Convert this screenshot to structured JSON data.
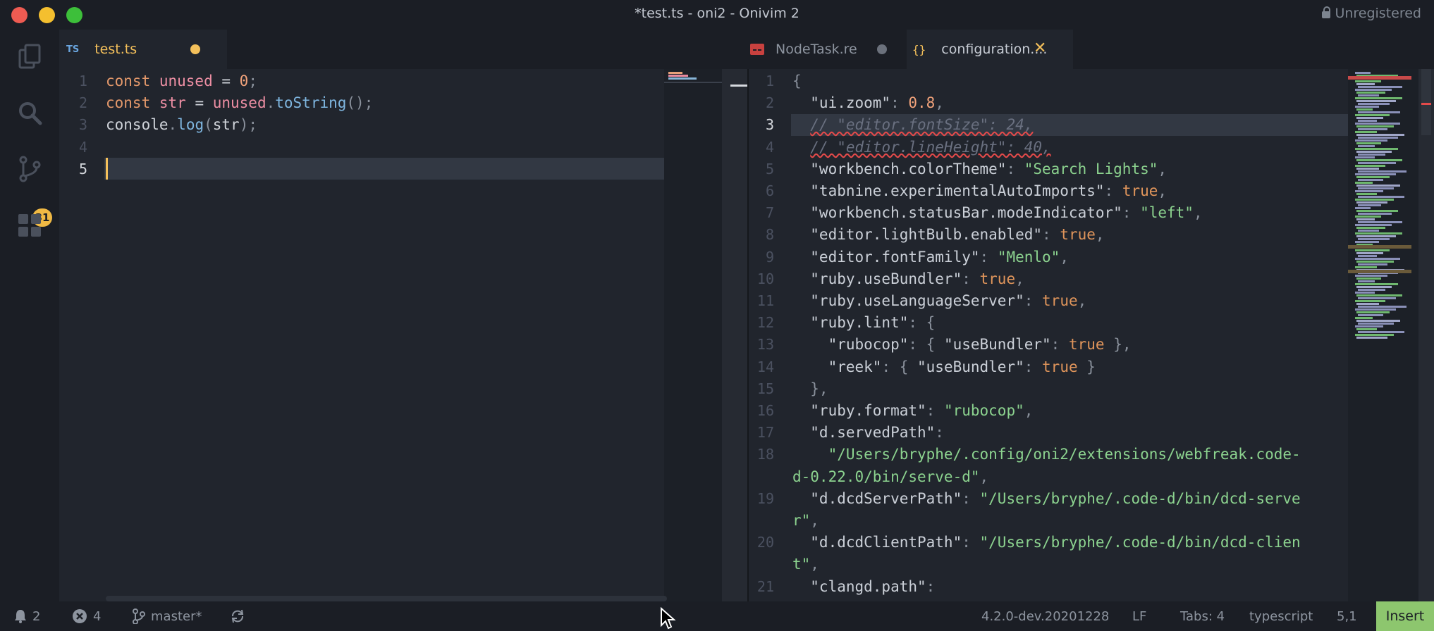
{
  "window": {
    "title": "*test.ts - oni2 - Onivim 2",
    "registration": "Unregistered"
  },
  "activity": {
    "scm_badge": "31"
  },
  "left_tabs": [
    {
      "icon": "TS",
      "label": "test.ts"
    }
  ],
  "right_tabs": [
    {
      "label": "NodeTask.re"
    },
    {
      "label": "configuration...."
    }
  ],
  "left_editor": {
    "line_numbers": [
      "1",
      "2",
      "3",
      "4",
      "5"
    ],
    "lines": [
      [
        [
          "kw",
          "const "
        ],
        [
          "var",
          "unused"
        ],
        [
          "pl",
          " = "
        ],
        [
          "num",
          "0"
        ],
        [
          "pn",
          ";"
        ]
      ],
      [
        [
          "kw",
          "const "
        ],
        [
          "var",
          "str"
        ],
        [
          "pl",
          " = "
        ],
        [
          "var",
          "unused"
        ],
        [
          "pn",
          "."
        ],
        [
          "fn",
          "toString"
        ],
        [
          "pn",
          "();"
        ]
      ],
      [
        [
          "pl",
          "console"
        ],
        [
          "pn",
          "."
        ],
        [
          "fn",
          "log"
        ],
        [
          "pn",
          "("
        ],
        [
          "pl",
          "str"
        ],
        [
          "pn",
          ");"
        ]
      ],
      [],
      []
    ]
  },
  "right_editor": {
    "line_numbers": [
      "1",
      "2",
      "3",
      "4",
      "5",
      "6",
      "7",
      "8",
      "9",
      "10",
      "11",
      "12",
      "13",
      "14",
      "15",
      "16",
      "17",
      "18",
      "",
      "19",
      "",
      "20",
      "",
      "21"
    ],
    "lines": [
      [
        [
          "pn",
          "{"
        ]
      ],
      [
        [
          "key",
          "  \"ui.zoom\""
        ],
        [
          "pn",
          ": "
        ],
        [
          "num",
          "0.8"
        ],
        [
          "pn",
          ","
        ]
      ],
      [
        [
          "pn",
          "  "
        ],
        [
          "cmt",
          "// \"editor.fontSize\": 24,"
        ]
      ],
      [
        [
          "pn",
          "  "
        ],
        [
          "cmt",
          "// \"editor.lineHeight\": 40,"
        ]
      ],
      [
        [
          "key",
          "  \"workbench.colorTheme\""
        ],
        [
          "pn",
          ": "
        ],
        [
          "str",
          "\"Search Lights\""
        ],
        [
          "pn",
          ","
        ]
      ],
      [
        [
          "key",
          "  \"tabnine.experimentalAutoImports\""
        ],
        [
          "pn",
          ": "
        ],
        [
          "bool",
          "true"
        ],
        [
          "pn",
          ","
        ]
      ],
      [
        [
          "key",
          "  \"workbench.statusBar.modeIndicator\""
        ],
        [
          "pn",
          ": "
        ],
        [
          "str",
          "\"left\""
        ],
        [
          "pn",
          ","
        ]
      ],
      [
        [
          "key",
          "  \"editor.lightBulb.enabled\""
        ],
        [
          "pn",
          ": "
        ],
        [
          "bool",
          "true"
        ],
        [
          "pn",
          ","
        ]
      ],
      [
        [
          "key",
          "  \"editor.fontFamily\""
        ],
        [
          "pn",
          ": "
        ],
        [
          "str",
          "\"Menlo\""
        ],
        [
          "pn",
          ","
        ]
      ],
      [
        [
          "key",
          "  \"ruby.useBundler\""
        ],
        [
          "pn",
          ": "
        ],
        [
          "bool",
          "true"
        ],
        [
          "pn",
          ","
        ]
      ],
      [
        [
          "key",
          "  \"ruby.useLanguageServer\""
        ],
        [
          "pn",
          ": "
        ],
        [
          "bool",
          "true"
        ],
        [
          "pn",
          ","
        ]
      ],
      [
        [
          "key",
          "  \"ruby.lint\""
        ],
        [
          "pn",
          ": {"
        ]
      ],
      [
        [
          "key",
          "    \"rubocop\""
        ],
        [
          "pn",
          ": { "
        ],
        [
          "key",
          "\"useBundler\""
        ],
        [
          "pn",
          ": "
        ],
        [
          "bool",
          "true"
        ],
        [
          "pn",
          " },"
        ]
      ],
      [
        [
          "key",
          "    \"reek\""
        ],
        [
          "pn",
          ": { "
        ],
        [
          "key",
          "\"useBundler\""
        ],
        [
          "pn",
          ": "
        ],
        [
          "bool",
          "true"
        ],
        [
          "pn",
          " }"
        ]
      ],
      [
        [
          "pn",
          "  },"
        ]
      ],
      [
        [
          "key",
          "  \"ruby.format\""
        ],
        [
          "pn",
          ": "
        ],
        [
          "str",
          "\"rubocop\""
        ],
        [
          "pn",
          ","
        ]
      ],
      [
        [
          "key",
          "  \"d.servedPath\""
        ],
        [
          "pn",
          ":"
        ]
      ],
      [
        [
          "str",
          "    \"/Users/bryphe/.config/oni2/extensions/webfreak.code-"
        ]
      ],
      [
        [
          "str",
          "d-0.22.0/bin/serve-d\""
        ],
        [
          "pn",
          ","
        ]
      ],
      [
        [
          "key",
          "  \"d.dcdServerPath\""
        ],
        [
          "pn",
          ": "
        ],
        [
          "str",
          "\"/Users/bryphe/.code-d/bin/dcd-serve"
        ]
      ],
      [
        [
          "str",
          "r\""
        ],
        [
          "pn",
          ","
        ]
      ],
      [
        [
          "key",
          "  \"d.dcdClientPath\""
        ],
        [
          "pn",
          ": "
        ],
        [
          "str",
          "\"/Users/bryphe/.code-d/bin/dcd-clien"
        ]
      ],
      [
        [
          "str",
          "t\""
        ],
        [
          "pn",
          ","
        ]
      ],
      [
        [
          "key",
          "  \"clangd.path\""
        ],
        [
          "pn",
          ":"
        ]
      ]
    ]
  },
  "status": {
    "notifications": "2",
    "errors": "4",
    "branch": "master*",
    "version": "4.2.0-dev.20201228",
    "eol": "LF",
    "tabs": "Tabs: 4",
    "language": "typescript",
    "position": "5,1",
    "mode": "Insert"
  },
  "colors": {
    "accent": "#f4c05b",
    "insert_mode": "#8dc66e",
    "background": "#21252d"
  }
}
